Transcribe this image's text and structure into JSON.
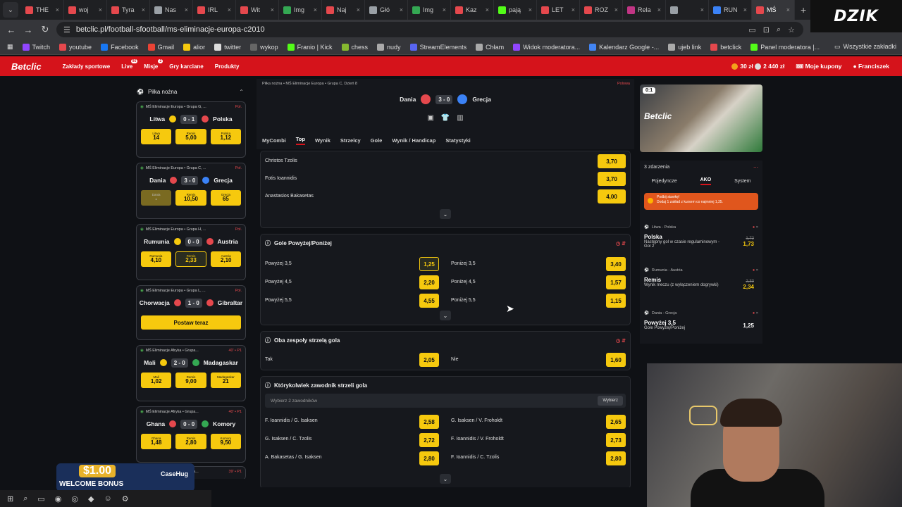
{
  "browser": {
    "tabs": [
      {
        "label": "THE",
        "color": "#e5484d"
      },
      {
        "label": "woj",
        "color": "#e5484d"
      },
      {
        "label": "Tyra",
        "color": "#e5484d"
      },
      {
        "label": "Nas",
        "color": "#9aa0a6"
      },
      {
        "label": "IRL",
        "color": "#e5484d"
      },
      {
        "label": "Wit",
        "color": "#e5484d"
      },
      {
        "label": "Img",
        "color": "#34a853"
      },
      {
        "label": "Naj",
        "color": "#e5484d"
      },
      {
        "label": "Głó",
        "color": "#9aa0a6"
      },
      {
        "label": "Img",
        "color": "#34a853"
      },
      {
        "label": "Kaz",
        "color": "#e5484d"
      },
      {
        "label": "pają",
        "color": "#53fc18"
      },
      {
        "label": "LET",
        "color": "#e5484d"
      },
      {
        "label": "ROZ",
        "color": "#e5484d"
      },
      {
        "label": "Rela",
        "color": "#c13584"
      },
      {
        "label": "",
        "color": "#9aa0a6"
      },
      {
        "label": "RUN",
        "color": "#3b82f6"
      },
      {
        "label": "MŚ",
        "color": "#e5484d"
      }
    ],
    "url": "betclic.pl/football-sfootball/ms-eliminacje-europa-c2010",
    "bookmarks": [
      "Twitch",
      "youtube",
      "Facebook",
      "Gmail",
      "alior",
      "twitter",
      "wykop",
      "Franio | Kick",
      "chess",
      "nudy",
      "StreamElements",
      "Chłam",
      "Widok moderatora...",
      "Kalendarz Google -...",
      "ujeb link",
      "betclick",
      "Panel moderatora |..."
    ],
    "bookmarks_right": "Wszystkie zakładki"
  },
  "overlay": {
    "brand": "DZIK"
  },
  "header": {
    "logo": "Betclic",
    "nav": [
      {
        "label": "Zakłady sportowe"
      },
      {
        "label": "Live",
        "badge": "95"
      },
      {
        "label": "Misje",
        "badge": "2"
      },
      {
        "label": "Gry karciane"
      },
      {
        "label": "Produkty"
      }
    ],
    "balance": "30 zł",
    "balance2": "2 440 zł",
    "coupons": "Moje kupony",
    "user": "Franciszek"
  },
  "sidebar": {
    "title": "Piłka nożna",
    "matches": [
      {
        "comp": "MŚ Eliminacje Europa • Grupa G, ...",
        "live": "Poł.",
        "home": "Litwa",
        "away": "Polska",
        "score": "0 - 1",
        "flag_home": "#f6c90e",
        "flag_away": "#e5484d",
        "odds": [
          {
            "label": "Litwa",
            "value": "14"
          },
          {
            "label": "Remis",
            "value": "5,00"
          },
          {
            "label": "Polska",
            "value": "1,12"
          }
        ]
      },
      {
        "comp": "MŚ Eliminacje Europa • Grupa C, ...",
        "live": "Poł.",
        "home": "Dania",
        "away": "Grecja",
        "score": "3 - 0",
        "flag_home": "#e5484d",
        "flag_away": "#3b82f6",
        "odds": [
          {
            "label": "Dania",
            "value": "-"
          },
          {
            "label": "Remis",
            "value": "10,50"
          },
          {
            "label": "Grecja",
            "value": "65"
          }
        ]
      },
      {
        "comp": "MŚ Eliminacje Europa • Grupa H, ...",
        "live": "Poł.",
        "home": "Rumunia",
        "away": "Austria",
        "score": "0 - 0",
        "flag_home": "#f6c90e",
        "flag_away": "#e5484d",
        "odds": [
          {
            "label": "Rumunia",
            "value": "4,10"
          },
          {
            "label": "Remis",
            "value": "2,33"
          },
          {
            "label": "Austria",
            "value": "2,10"
          }
        ]
      },
      {
        "comp": "MŚ Eliminacje Europa • Grupa L, ...",
        "live": "Poł.",
        "home": "Chorwacja",
        "away": "Gibraltar",
        "score": "1 - 0",
        "flag_home": "#e5484d",
        "flag_away": "#e5484d",
        "cta": "Postaw teraz"
      },
      {
        "comp": "MŚ Eliminacje Afryka • Grupa...",
        "live": "40' • P1",
        "home": "Mali",
        "away": "Madagaskar",
        "score": "2 - 0",
        "flag_home": "#f6c90e",
        "flag_away": "#34a853",
        "odds": [
          {
            "label": "Mali",
            "value": "1,02"
          },
          {
            "label": "Remis",
            "value": "9,00"
          },
          {
            "label": "Madagaskar",
            "value": "21"
          }
        ]
      },
      {
        "comp": "MŚ Eliminacje Afryka • Grupa...",
        "live": "40' • P1",
        "home": "Ghana",
        "away": "Komory",
        "score": "0 - 0",
        "flag_home": "#e5484d",
        "flag_away": "#34a853",
        "odds": [
          {
            "label": "Ghana",
            "value": "1,48"
          },
          {
            "label": "Remis",
            "value": "2,80"
          },
          {
            "label": "Komory",
            "value": "9,50"
          }
        ]
      },
      {
        "comp": "MŚ Eliminacje Afryka • Grupa...",
        "live": "39' • P1"
      }
    ]
  },
  "event": {
    "crumb": "Piłka nożna • MŚ Eliminacje Europa • Grupa C, Dzień 8",
    "lang": "Polowa",
    "home": "Dania",
    "away": "Grecja",
    "score": "3 - 0",
    "tabs": [
      "MyCombi",
      "Top",
      "Wynik",
      "Strzelcy",
      "Gole",
      "Wynik / Handicap",
      "Statystyki"
    ]
  },
  "scorers": [
    {
      "name": "Christos Tzolis",
      "odd": "3,70"
    },
    {
      "name": "Fotis Ioannidis",
      "odd": "3,70"
    },
    {
      "name": "Anastasios Bakasetas",
      "odd": "4,00"
    }
  ],
  "overunder": {
    "title": "Gole Powyżej/Poniżej",
    "rows": [
      {
        "over": "Powyżej 3,5",
        "over_odd": "1,25",
        "under": "Poniżej 3,5",
        "under_odd": "3,40"
      },
      {
        "over": "Powyżej 4,5",
        "over_odd": "2,20",
        "under": "Poniżej 4,5",
        "under_odd": "1,57"
      },
      {
        "over": "Powyżej 5,5",
        "over_odd": "4,55",
        "under": "Poniżej 5,5",
        "under_odd": "1,15"
      }
    ]
  },
  "btts": {
    "title": "Oba zespoły strzelą gola",
    "yes": "Tak",
    "yes_odd": "2,05",
    "no": "Nie",
    "no_odd": "1,60"
  },
  "anyscorer": {
    "title": "Którykolwiek zawodnik strzeli gola",
    "placeholder": "Wybierz 2 zawodników",
    "button": "Wybierz",
    "rows": [
      {
        "l": "F. Ioannidis / G. Isaksen",
        "lo": "2,58",
        "r": "G. Isaksen / V. Froholdt",
        "ro": "2,65"
      },
      {
        "l": "G. Isaksen / C. Tzolis",
        "lo": "2,72",
        "r": "F. Ioannidis / V. Froholdt",
        "ro": "2,73"
      },
      {
        "l": "A. Bakasetas / G. Isaksen",
        "lo": "2,80",
        "r": "F. Ioannidis / C. Tzolis",
        "ro": "2,80"
      }
    ]
  },
  "stream": {
    "score": "0:1",
    "brand": "Betclic"
  },
  "coupon": {
    "count": "3 zdarzenia",
    "tabs": [
      "Pojedyncze",
      "AKO",
      "System"
    ],
    "promo": "Podbij stawkę!\nDodaj 1 zakład z kursem co najmniej 1,35.",
    "items": [
      {
        "match": "Litwa - Polska",
        "pick": "Polska",
        "market": "Następny gol w czasie regulaminowym - Gol 2",
        "old": "1,72",
        "odd": "1,73"
      },
      {
        "match": "Rumunia - Austria",
        "pick": "Remis",
        "market": "Wynik meczu (z wyłączeniem dogrywki)",
        "old": "2,33",
        "odd": "2,34"
      },
      {
        "match": "Dania - Grecja",
        "pick": "Powyżej 3,5",
        "market": "Gole Powyżej/Poniżej",
        "old": "",
        "odd": "1,25"
      }
    ]
  },
  "bonus": {
    "amount": "$1.00",
    "label": "WELCOME BONUS",
    "sponsor": "CaseHug"
  }
}
